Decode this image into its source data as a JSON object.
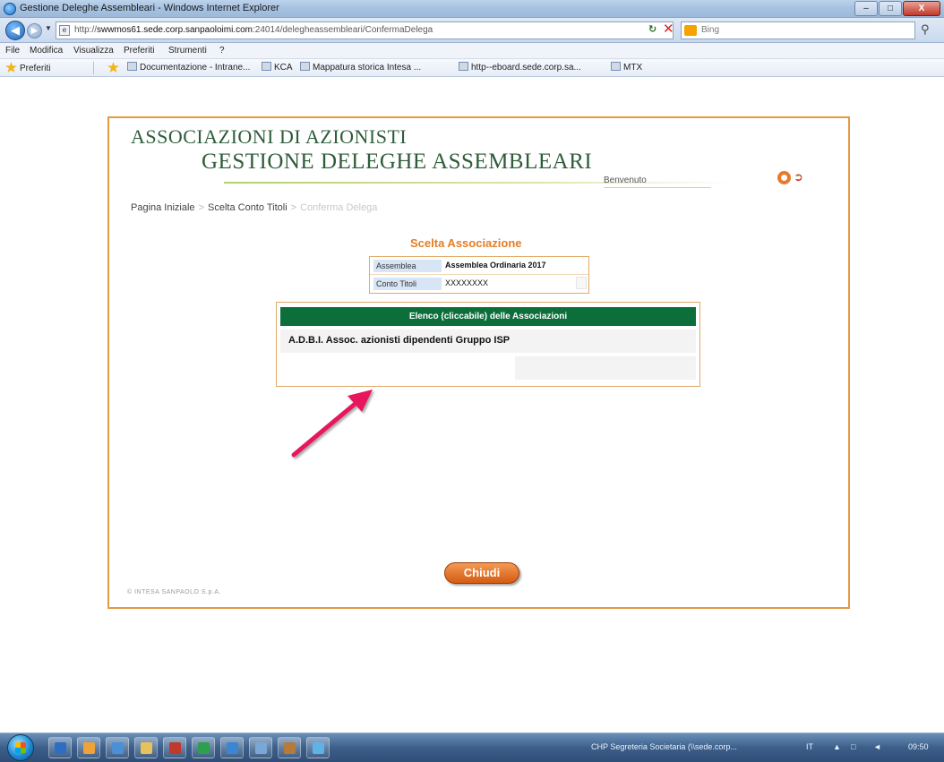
{
  "window": {
    "title": "Gestione Deleghe Assembleari - Windows Internet Explorer",
    "btn_minimize": "–",
    "btn_maximize": "□",
    "btn_close": "X"
  },
  "addressbar": {
    "url_prefix": "http://",
    "url_domain": "swwmos61.sede.corp.sanpaoloimi.com",
    "url_path": ":24014/delegheassembleari/ConfermaDelega",
    "search_label": "Bing"
  },
  "menu": [
    "File",
    "Modifica",
    "Visualizza",
    "Preferiti",
    "Strumenti",
    "?"
  ],
  "favorites": {
    "label": "Preferiti",
    "items": [
      "Documentazione - Intrane...",
      "KCA",
      "Mappatura storica Intesa ...",
      "http--eboard.sede.corp.sa...",
      "MTX"
    ]
  },
  "app": {
    "title_line1": "ASSOCIAZIONI DI AZIONISTI",
    "title_line2": "GESTIONE DELEGHE ASSEMBLEARI",
    "welcome": "Benvenuto",
    "breadcrumb": {
      "home": "Pagina Iniziale",
      "step2": "Scelta Conto Titoli",
      "step3": "Conferma Delega",
      "separator": ">"
    },
    "section_title": "Scelta Associazione",
    "info": {
      "assemblea_label": "Assemblea",
      "assemblea_value": "Assemblea Ordinaria 2017",
      "conto_label": "Conto Titoli",
      "conto_value": "XXXXXXXX"
    },
    "assoc": {
      "header": "Elenco (cliccabile) delle Associazioni",
      "items": [
        "A.D.B.I. Assoc. azionisti dipendenti Gruppo ISP"
      ]
    },
    "close_button": "Chiudi",
    "footer": "© INTESA SANPAOLO S.p.A."
  },
  "annotation": {
    "arrow_color": "#e8175d"
  },
  "taskbar": {
    "tray_label": "CHP Segreteria Societaria (\\\\sede.corp...",
    "lang": "IT",
    "clock": "09:50"
  }
}
